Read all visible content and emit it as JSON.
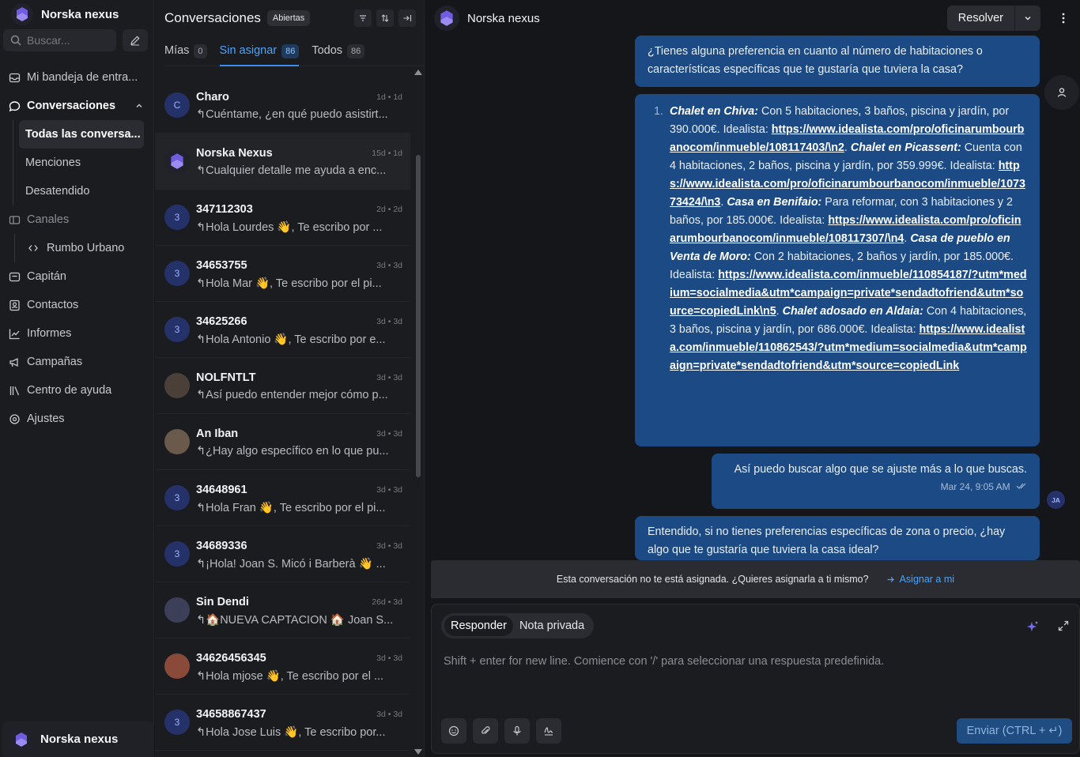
{
  "sidebar": {
    "brand": "Norska nexus",
    "search_placeholder": "Buscar...",
    "items": {
      "inbox": "Mi bandeja de entra...",
      "conversations": "Conversaciones",
      "all": "Todas las conversa...",
      "mentions": "Menciones",
      "unattended": "Desatendido",
      "channels": "Canales",
      "channel_1": "Rumbo Urbano",
      "captain": "Capitán",
      "contacts": "Contactos",
      "reports": "Informes",
      "campaigns": "Campañas",
      "help_center": "Centro de ayuda",
      "settings": "Ajustes"
    },
    "footer_name": "Norska nexus"
  },
  "list": {
    "title": "Conversaciones",
    "status_chip": "Abiertas",
    "tabs": [
      {
        "label": "Mías",
        "count": "0"
      },
      {
        "label": "Sin asignar",
        "count": "86"
      },
      {
        "label": "Todos",
        "count": "86"
      }
    ],
    "conversations": [
      {
        "initial": "C",
        "name": "Charo",
        "time": "1d • 1d",
        "message": "↰Cuéntame, ¿en qué puedo asistirt..."
      },
      {
        "initial": "",
        "name": "Norska Nexus",
        "time": "15d • 1d",
        "message": "↰Cualquier detalle me ayuda a enc..."
      },
      {
        "initial": "3",
        "name": "347112303",
        "time": "2d • 2d",
        "message": "↰Hola Lourdes 👋, Te escribo por ..."
      },
      {
        "initial": "3",
        "name": "34653755",
        "time": "3d • 3d",
        "message": "↰Hola Mar 👋, Te escribo por el pi..."
      },
      {
        "initial": "3",
        "name": "34625266",
        "time": "3d • 3d",
        "message": "↰Hola Antonio 👋, Te escribo por e..."
      },
      {
        "initial": "",
        "name": "NOLFNTLT",
        "time": "3d • 3d",
        "message": "↰Así puedo entender mejor cómo p..."
      },
      {
        "initial": "",
        "name": "An   Iban",
        "time": "3d • 3d",
        "message": "↰¿Hay algo específico en lo que pu..."
      },
      {
        "initial": "3",
        "name": "34648961",
        "time": "3d • 3d",
        "message": "↰Hola Fran 👋, Te escribo por el pi..."
      },
      {
        "initial": "3",
        "name": "34689336",
        "time": "3d • 3d",
        "message": "↰¡Hola! Joan S. Micó i Barberà 👋 ..."
      },
      {
        "initial": "",
        "name": "Sin Dendi",
        "time": "26d • 3d",
        "message": "↰🏠NUEVA CAPTACION 🏠 Joan S..."
      },
      {
        "initial": "",
        "name": "34626456345",
        "time": "3d • 3d",
        "message": "↰Hola mjose 👋, Te escribo por el ..."
      },
      {
        "initial": "3",
        "name": "34658867437",
        "time": "3d • 3d",
        "message": "↰Hola Jose Luis 👋, Te escribo por..."
      }
    ]
  },
  "chat": {
    "name": "Norska nexus",
    "resolve_label": "Resolver",
    "messages": {
      "m1": "¿Tienes alguna preferencia en cuanto al número de habitaciones o características específicas que te gustaría que tuviera la casa?",
      "m2_num": "1.",
      "m2_p1_title": "Chalet en Chiva:",
      "m2_p1_text": " Con 5 habitaciones, 3 baños, piscina y jardín, por 390.000€. Idealista: ",
      "m2_p1_link": "https://www.idealista.com/pro/oficinarumbourbanocom/inmueble/108117403/\\n2",
      "m2_p2_title": "Chalet en Picassent:",
      "m2_p2_text": " Cuenta con 4 habitaciones, 2 baños, piscina y jardín, por 359.999€. Idealista: ",
      "m2_p2_link": "https://www.idealista.com/pro/oficinarumbourbanocom/inmueble/107373424/\\n3",
      "m2_p3_title": "Casa en Benifaio:",
      "m2_p3_text": " Para reformar, con 3 habitaciones y 2 baños, por 185.000€. Idealista: ",
      "m2_p3_link": "https://www.idealista.com/pro/oficinarumbourbanocom/inmueble/108117307/\\n4",
      "m2_p4_title": "Casa de pueblo en Venta de Moro:",
      "m2_p4_text": " Con 2 habitaciones, 2 baños y jardín, por 185.000€. Idealista: ",
      "m2_p4_link": "https://www.idealista.com/inmueble/110854187/?utm*medium=socialmedia&utm*campaign=private*sendadtofriend&utm*source=copiedLink\\n5",
      "m2_p5_title": "Chalet adosado en Aldaia:",
      "m2_p5_text": " Con 4 habitaciones, 3 baños, piscina y jardín, por 686.000€. Idealista: ",
      "m2_p5_link": "https://www.idealista.com/inmueble/110862543/?utm*medium=socialmedia&utm*campaign=private*sendadtofriend&utm*source=copiedLink",
      "m3": "Así puedo buscar algo que se ajuste más a lo que buscas.",
      "m3_time": "Mar 24, 9:05 AM",
      "m4": "Entendido, si no tienes preferencias específicas de zona o precio, ¿hay algo que te gustaría que tuviera la casa ideal?"
    },
    "agent_initials": "JA",
    "assign_notice": "Esta conversación no te está asignada. ¿Quieres asignarla a ti mismo?",
    "assign_link": "Asignar a mi",
    "reply_label": "Responder",
    "private_note_label": "Nota privada",
    "composer_placeholder": "Shift + enter for new line. Comience con '/' para seleccionar una respuesta predefinida.",
    "send_label": "Enviar (CTRL + ↵)"
  },
  "colors": {
    "accent": "#3a8ef0",
    "bubble": "#1b4a84",
    "sidebar_bg": "#1b1c20",
    "app_bg": "#151619"
  }
}
